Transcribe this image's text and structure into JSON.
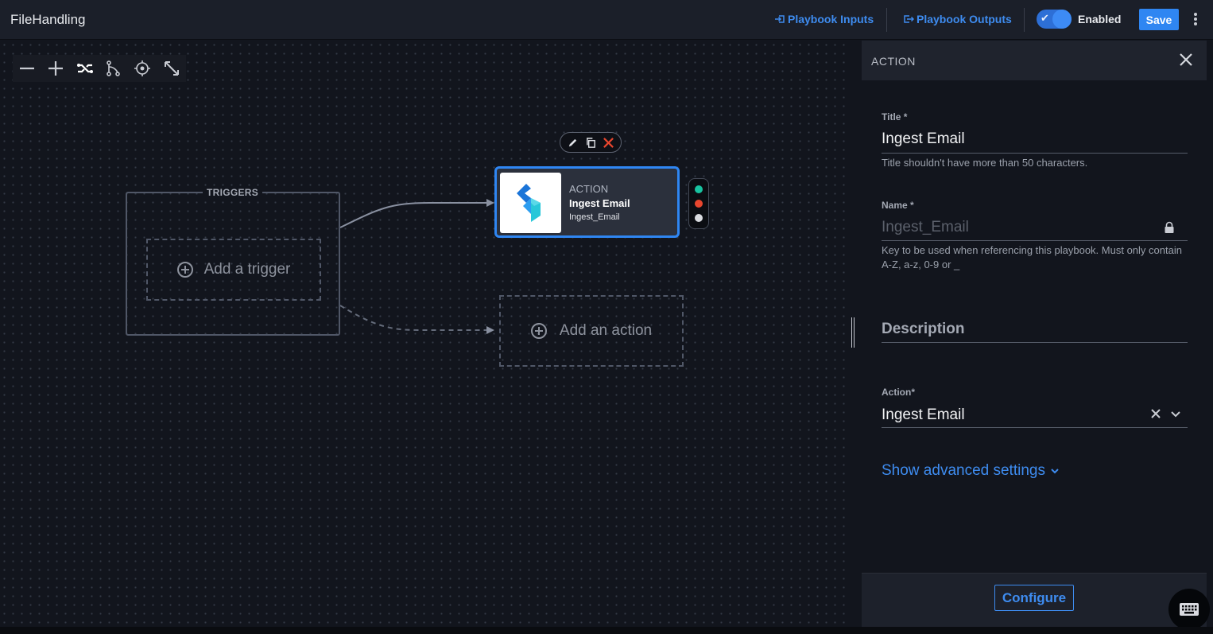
{
  "header": {
    "title": "FileHandling",
    "playbook_inputs": "Playbook Inputs",
    "playbook_outputs": "Playbook Outputs",
    "enabled_label": "Enabled",
    "enabled": true,
    "save_label": "Save"
  },
  "canvas": {
    "toolbar": [
      "minus-icon",
      "plus-icon",
      "auto-layout-icon",
      "branch-icon",
      "target-icon",
      "expand-icon"
    ],
    "triggers_label": "TRIGGERS",
    "add_trigger": "Add a trigger",
    "add_action": "Add an action",
    "node": {
      "type": "ACTION",
      "title": "Ingest Email",
      "name": "Ingest_Email"
    },
    "status_colors": [
      "#18c3a0",
      "#e8462e",
      "#d9dbe0"
    ]
  },
  "panel": {
    "header": "ACTION",
    "title_label": "Title *",
    "title_value": "Ingest Email",
    "title_help": "Title shouldn't have more than 50 characters.",
    "name_label": "Name *",
    "name_value": "Ingest_Email",
    "name_help": "Key to be used when referencing this playbook. Must only contain A-Z, a-z, 0-9 or _",
    "description_label": "Description",
    "action_label": "Action*",
    "action_value": "Ingest Email",
    "advanced_link": "Show advanced settings",
    "configure_label": "Configure"
  },
  "colors": {
    "accent": "#2f86f2",
    "background": "#12151d"
  }
}
